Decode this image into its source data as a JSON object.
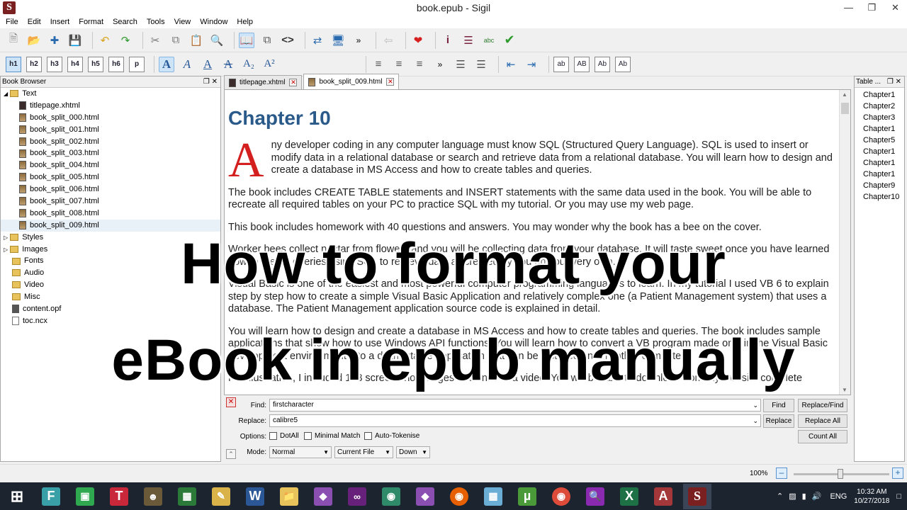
{
  "window": {
    "title": "book.epub - Sigil",
    "app_icon": "S"
  },
  "menu": [
    "File",
    "Edit",
    "Insert",
    "Format",
    "Search",
    "Tools",
    "View",
    "Window",
    "Help"
  ],
  "heading_buttons": [
    "h1",
    "h2",
    "h3",
    "h4",
    "h5",
    "h6",
    "p"
  ],
  "case_buttons": [
    "ab",
    "AB",
    "Ab",
    "Ab"
  ],
  "book_browser": {
    "title": "Book Browser",
    "text_folder": "Text",
    "files": [
      "titlepage.xhtml",
      "book_split_000.html",
      "book_split_001.html",
      "book_split_002.html",
      "book_split_003.html",
      "book_split_004.html",
      "book_split_005.html",
      "book_split_006.html",
      "book_split_007.html",
      "book_split_008.html",
      "book_split_009.html"
    ],
    "folders": [
      "Styles",
      "Images",
      "Fonts",
      "Audio",
      "Video",
      "Misc"
    ],
    "root_files": [
      "content.opf",
      "toc.ncx"
    ]
  },
  "tabs": [
    {
      "label": "titlepage.xhtml"
    },
    {
      "label": "book_split_009.html"
    }
  ],
  "editor": {
    "heading": "Chapter 10",
    "dropcap": "A",
    "paragraphs": [
      "ny developer coding in any computer language must know SQL (Structured Query Language). SQL is used to insert or modify data in a relational database or search and retrieve data from a relational database. You will learn how to design and create a database in MS Access and how to create tables and queries.",
      "The book includes CREATE TABLE statements and INSERT statements with the same data used in the book. You will be able to recreate all required tables on your PC to practice SQL with my tutorial. Or you may use my web page.",
      "This book includes homework with 40 questions and answers. You may wonder why the book has a bee on the cover.",
      "Worker bees collect nectar from flowers and you will be collecting data from your database. It will taste sweet once you have learned how to create queries using SQL to retrieve data all created by you on your very own.",
      "Visual Basic is one of the easiest and most powerful computer programming languages to learn. In my tutorial I used VB 6 to explain step by step how to create a simple Visual Basic Application and relatively complex one (a Patient Management system) that uses a database. The Patient Management application source code is explained in detail.",
      "You will learn how to design and create a database in MS Access and how to create tables and queries. The book includes sample applications that show how to use Windows API functions. You will learn how to convert a VB program made only in the Visual Basic development environment into a distributable application that can be installed on any other computer.",
      "For illustration, I included 128 screen shot images and links to a video. You will be able to download from my website complete"
    ]
  },
  "find_panel": {
    "find_label": "Find:",
    "find_value": "firstcharacter",
    "replace_label": "Replace:",
    "replace_value": "calibre5",
    "options_label": "Options:",
    "dotall": "DotAll",
    "minimal": "Minimal Match",
    "autotoken": "Auto-Tokenise",
    "mode_label": "Mode:",
    "mode": "Normal",
    "scope": "Current File",
    "direction": "Down",
    "btn_find": "Find",
    "btn_replace_find": "Replace/Find",
    "btn_replace": "Replace",
    "btn_replace_all": "Replace All",
    "btn_count_all": "Count All"
  },
  "toc": {
    "title": "Table ...",
    "items": [
      "Chapter1",
      "Chapter2",
      "Chapter3",
      "Chapter1",
      "Chapter5",
      "Chapter1",
      "Chapter1",
      "Chapter1",
      "Chapter9",
      "Chapter10"
    ]
  },
  "status": {
    "zoom": "100%"
  },
  "taskbar": {
    "time": "10:32 AM",
    "date": "10/27/2018",
    "lang": "ENG"
  },
  "overlay": {
    "line1": "How to format your",
    "line2": "eBook in epub manually"
  }
}
